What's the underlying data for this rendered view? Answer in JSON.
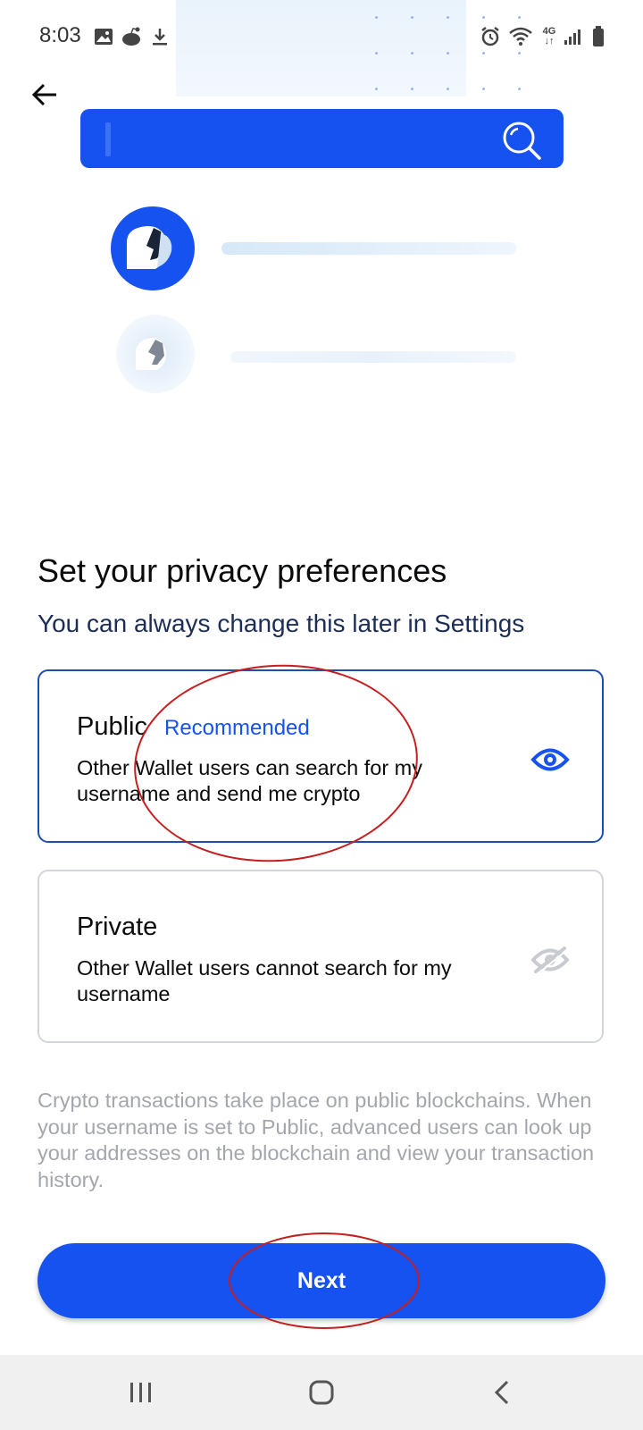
{
  "status_bar": {
    "time": "8:03",
    "network": "4G",
    "icons": [
      "image-icon",
      "reddit-icon",
      "download-icon",
      "dot-icon",
      "alarm-icon",
      "wifi-icon",
      "network-4g-icon",
      "signal-icon",
      "battery-icon"
    ]
  },
  "header": {
    "back_icon": "arrow-left-icon"
  },
  "illustration": {
    "search_icon": "magnifier-icon"
  },
  "privacy": {
    "title": "Set your privacy preferences",
    "subtitle": "You can always change this later in Settings",
    "options": [
      {
        "label": "Public",
        "badge": "Recommended",
        "description": "Other Wallet users can search for my username and send me crypto",
        "icon": "eye-icon",
        "selected": true
      },
      {
        "label": "Private",
        "badge": "",
        "description": "Other Wallet users cannot search for my username",
        "icon": "eye-off-icon",
        "selected": false
      }
    ],
    "note": "Crypto transactions take place on public blockchains. When your username is set to Public, advanced users can look up your addresses on the blockchain and view your transaction history."
  },
  "next_button": {
    "label": "Next"
  },
  "nav_bar": {
    "recent_icon": "recent-apps-icon",
    "home_icon": "home-icon",
    "back_icon": "back-chevron-icon"
  },
  "colors": {
    "brand": "#1652f0",
    "selected_border": "#1d4fb0",
    "annotation": "#c61e1e",
    "note_text": "#a3a7ad"
  }
}
